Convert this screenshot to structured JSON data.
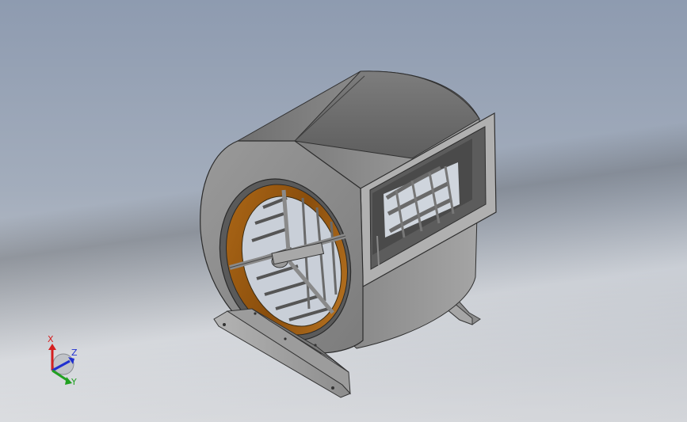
{
  "viewport": {
    "model": "centrifugal-blower",
    "background_top": "#8e9bb0",
    "background_bottom": "#d4d6da"
  },
  "triad": {
    "x_label": "X",
    "y_label": "Y",
    "z_label": "Z",
    "x_color": "#d42020",
    "y_color": "#20a020",
    "z_color": "#2030d0"
  }
}
